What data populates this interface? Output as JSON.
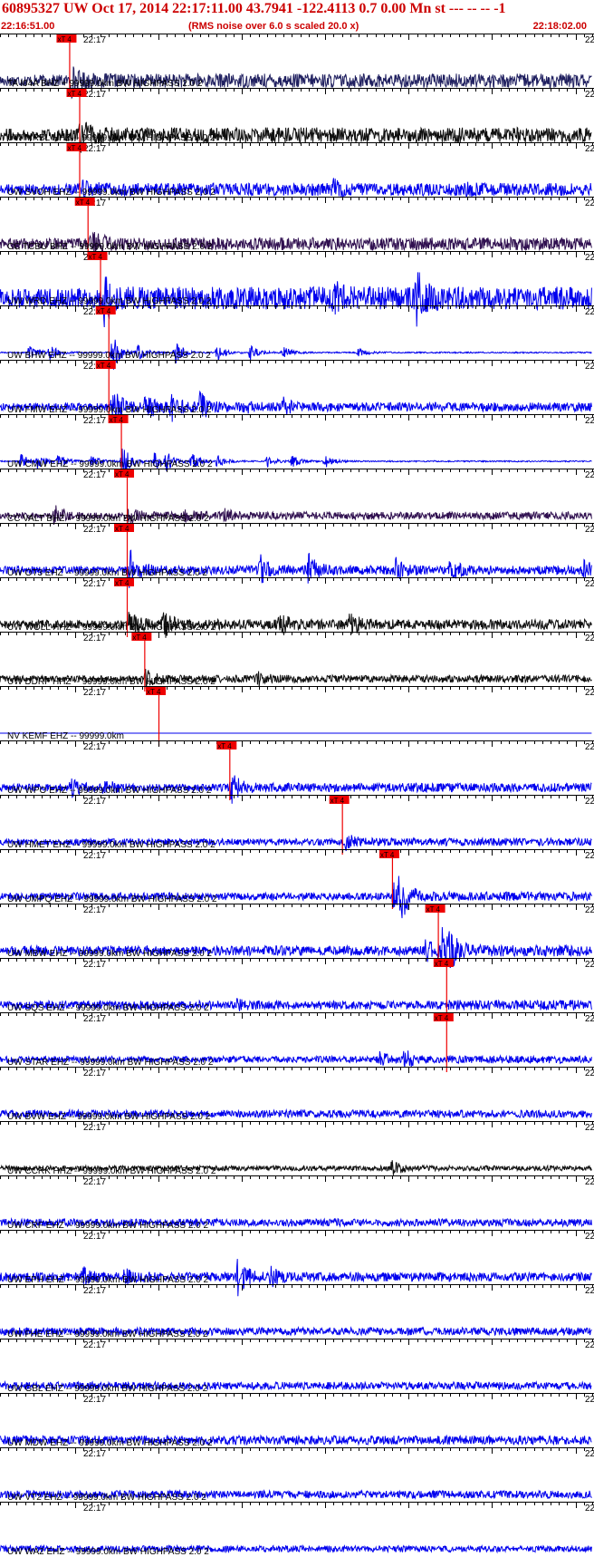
{
  "header": {
    "title": "60895327 UW Oct 17, 2014 22:17:11.00   43.7941 -122.4113  0.7 0.00 Mn st --- -- --  -1",
    "start_time": "22:16:51.00",
    "scale_note": "(RMS noise over 6.0 s scaled 20.0 x)",
    "end_time": "22:18:02.00"
  },
  "chart_data": {
    "type": "line",
    "tick_label": "22:17",
    "edge_tick_label": "22",
    "pick_label": "xT 4",
    "x_range_seconds": [
      0,
      71
    ],
    "tick_interval_seconds": 1,
    "series": [
      {
        "name": "TA I04A BHZ + 99999.0km BW  HIGHPASS  2.0  2",
        "color": "#202060",
        "pick_s": 8.3,
        "amp": 0.55,
        "bursts": [
          [
            8.5,
            1.0
          ]
        ]
      },
      {
        "name": "UW MRBL HHZ -- 99999.0km BW  HIGHPASS  2.0  2",
        "color": "#101010",
        "pick_s": 9.5,
        "amp": 0.6,
        "bursts": [
          [
            9.7,
            0.9
          ]
        ]
      },
      {
        "name": "UW SVOH EHZ -- 99999.0km BW  HIGHPASS  2.0  2",
        "color": "#0000ee",
        "pick_s": 9.5,
        "amp": 0.5,
        "bursts": [
          [
            9.9,
            0.6
          ],
          [
            40,
            0.5
          ],
          [
            56,
            0.4
          ]
        ]
      },
      {
        "name": "CC TCBU BHZ -- 99999.0km BW  HIGHPASS  2.0  2",
        "color": "#301050",
        "pick_s": 10.5,
        "amp": 0.5,
        "bursts": [
          [
            10.9,
            1.2
          ]
        ]
      },
      {
        "name": "UW WRD EHZ -- 99999.0km BW  HIGHPASS  2.0  2",
        "color": "#0000ee",
        "pick_s": 12.0,
        "amp": 0.9,
        "bursts": [
          [
            12.5,
            1.4
          ],
          [
            40,
            0.8
          ],
          [
            50,
            1.6
          ]
        ]
      },
      {
        "name": "UW BHW EHZ -- 99999.0km BW  HIGHPASS  2.0  2",
        "color": "#0000ee",
        "pick_s": 13.0,
        "amp": 0.05,
        "bursts": [
          [
            3.5,
            0.6
          ],
          [
            6,
            0.6
          ],
          [
            13.5,
            1.5
          ],
          [
            16.5,
            0.8
          ],
          [
            21,
            1.0
          ],
          [
            26,
            0.7
          ],
          [
            30,
            0.6
          ],
          [
            34,
            0.5
          ],
          [
            43,
            0.4
          ]
        ]
      },
      {
        "name": "UW FMW EHZ -- 99999.0km BW  HIGHPASS  2.0  2",
        "color": "#0000ee",
        "pick_s": 13.0,
        "amp": 0.35,
        "bursts": [
          [
            13.5,
            1.5
          ],
          [
            17.5,
            1.0
          ],
          [
            20.5,
            1.2
          ],
          [
            24,
            1.0
          ],
          [
            29,
            0.5
          ],
          [
            34,
            0.5
          ]
        ]
      },
      {
        "name": "UW CMW EHZ -- 99999.0km BW  HIGHPASS  2.0  2",
        "color": "#0000ee",
        "pick_s": 14.5,
        "amp": 0.05,
        "bursts": [
          [
            2.5,
            0.6
          ],
          [
            4.5,
            0.6
          ],
          [
            7,
            0.6
          ],
          [
            11,
            0.5
          ],
          [
            14.7,
            1.3
          ],
          [
            18.5,
            0.7
          ],
          [
            20,
            0.8
          ],
          [
            23,
            0.6
          ],
          [
            26,
            0.5
          ],
          [
            32,
            0.5
          ],
          [
            35,
            0.5
          ],
          [
            39,
            0.5
          ]
        ]
      },
      {
        "name": "CC VALT BHZ -- 99999.0km BW  HIGHPASS  2.0  2",
        "color": "#301050",
        "pick_s": 15.2,
        "amp": 0.3,
        "bursts": [
          [
            6.5,
            0.9
          ],
          [
            15.5,
            0.5
          ],
          [
            22,
            0.4
          ],
          [
            27,
            0.4
          ]
        ]
      },
      {
        "name": "UW OT3 EHZ -- 99999.0km BW  HIGHPASS  2.0  2",
        "color": "#0000ee",
        "pick_s": 15.2,
        "amp": 0.35,
        "bursts": [
          [
            15.6,
            1.6
          ],
          [
            31,
            1.2
          ],
          [
            37,
            1.1
          ],
          [
            47.5,
            0.8
          ],
          [
            54,
            0.7
          ],
          [
            70,
            0.6
          ]
        ]
      },
      {
        "name": "UW WOLL HHZ -- 99999.0km BW  HIGHPASS  2.0  2",
        "color": "#101010",
        "pick_s": 15.2,
        "amp": 0.4,
        "bursts": [
          [
            15.5,
            0.9
          ],
          [
            19.5,
            1.0
          ],
          [
            33.5,
            0.8
          ],
          [
            42,
            0.9
          ]
        ]
      },
      {
        "name": "UW DDRF HHZ -- 99999.0km BW  HIGHPASS  2.0  2",
        "color": "#101010",
        "pick_s": 17.3,
        "amp": 0.3,
        "bursts": [
          [
            17.5,
            0.6
          ],
          [
            31,
            0.4
          ]
        ]
      },
      {
        "name": "NV KEMF EHZ -- 99999.0km",
        "color": "#0000ee",
        "pick_s": 19.0,
        "amp": 0.0,
        "bursts": []
      },
      {
        "name": "UW WPO EHZ -- 99999.0km BW  HIGHPASS  2.0  2",
        "color": "#0000ee",
        "pick_s": 27.5,
        "amp": 0.35,
        "bursts": [
          [
            8.5,
            0.7
          ],
          [
            12.5,
            0.6
          ],
          [
            27.8,
            1.0
          ]
        ]
      },
      {
        "name": "UW HMET EHZ -- 99999.0km BW  HIGHPASS  2.0  2",
        "color": "#0000ee",
        "pick_s": 41.0,
        "amp": 0.3,
        "bursts": [
          [
            41.5,
            0.5
          ]
        ]
      },
      {
        "name": "UW UMPQ EHZ -- 99999.0km BW  HIGHPASS  2.0  2",
        "color": "#0000ee",
        "pick_s": 47.0,
        "amp": 0.35,
        "bursts": [
          [
            47.3,
            1.7
          ],
          [
            48,
            1.4
          ]
        ]
      },
      {
        "name": "UW MBW EHZ -- 99999.0km BW  HIGHPASS  2.0  2",
        "color": "#0000ee",
        "pick_s": 52.5,
        "amp": 0.45,
        "bursts": [
          [
            51,
            0.8
          ],
          [
            53,
            1.4
          ],
          [
            54,
            1.0
          ]
        ]
      },
      {
        "name": "UW SQS EHZ -- 99999.0km BW  HIGHPASS  2.0  2",
        "color": "#0000ee",
        "pick_s": 53.5,
        "amp": 0.4,
        "bursts": [
          [
            28.5,
            0.4
          ]
        ]
      },
      {
        "name": "UW STAR EHZ -- 99999.0km BW  HIGHPASS  2.0  2",
        "color": "#0000ee",
        "pick_s": 53.5,
        "amp": 0.3,
        "bursts": [
          [
            45.5,
            0.6
          ],
          [
            48.5,
            0.8
          ]
        ]
      },
      {
        "name": "UW BVW EHZ -- 99999.0km BW  HIGHPASS  2.0  2",
        "color": "#0000ee",
        "pick_s": null,
        "amp": 0.3,
        "bursts": []
      },
      {
        "name": "UW CCRK HHZ -- 99999.0km BW  HIGHPASS  2.0  2",
        "color": "#101010",
        "pick_s": null,
        "amp": 0.2,
        "bursts": [
          [
            47,
            0.6
          ]
        ]
      },
      {
        "name": "UW CRF EHZ -- 99999.0km BW  HIGHPASS  2.0  2",
        "color": "#0000ee",
        "pick_s": null,
        "amp": 0.3,
        "bursts": []
      },
      {
        "name": "UW EPH EHZ -- 99999.0km BW  HIGHPASS  2.0  2",
        "color": "#0000ee",
        "pick_s": null,
        "amp": 0.35,
        "bursts": [
          [
            10,
            0.7
          ],
          [
            15,
            0.5
          ],
          [
            28.5,
            1.6
          ],
          [
            32.5,
            0.6
          ]
        ]
      },
      {
        "name": "UW FHE EHZ -- 99999.0km BW  HIGHPASS  2.0  2",
        "color": "#0000ee",
        "pick_s": null,
        "amp": 0.3,
        "bursts": []
      },
      {
        "name": "UW GBL EHZ -- 99999.0km BW  HIGHPASS  2.0  2",
        "color": "#0000ee",
        "pick_s": null,
        "amp": 0.3,
        "bursts": []
      },
      {
        "name": "UW MDW EHZ -- 99999.0km BW  HIGHPASS  2.0  2",
        "color": "#0000ee",
        "pick_s": null,
        "amp": 0.35,
        "bursts": []
      },
      {
        "name": "UW VT2 EHZ -- 99999.0km BW  HIGHPASS  2.0  2",
        "color": "#0000ee",
        "pick_s": null,
        "amp": 0.3,
        "bursts": []
      },
      {
        "name": "UW WA2 EHZ -- 99999.0km BW  HIGHPASS  2.0  2",
        "color": "#0000ee",
        "pick_s": null,
        "amp": 0.25,
        "bursts": []
      }
    ]
  }
}
